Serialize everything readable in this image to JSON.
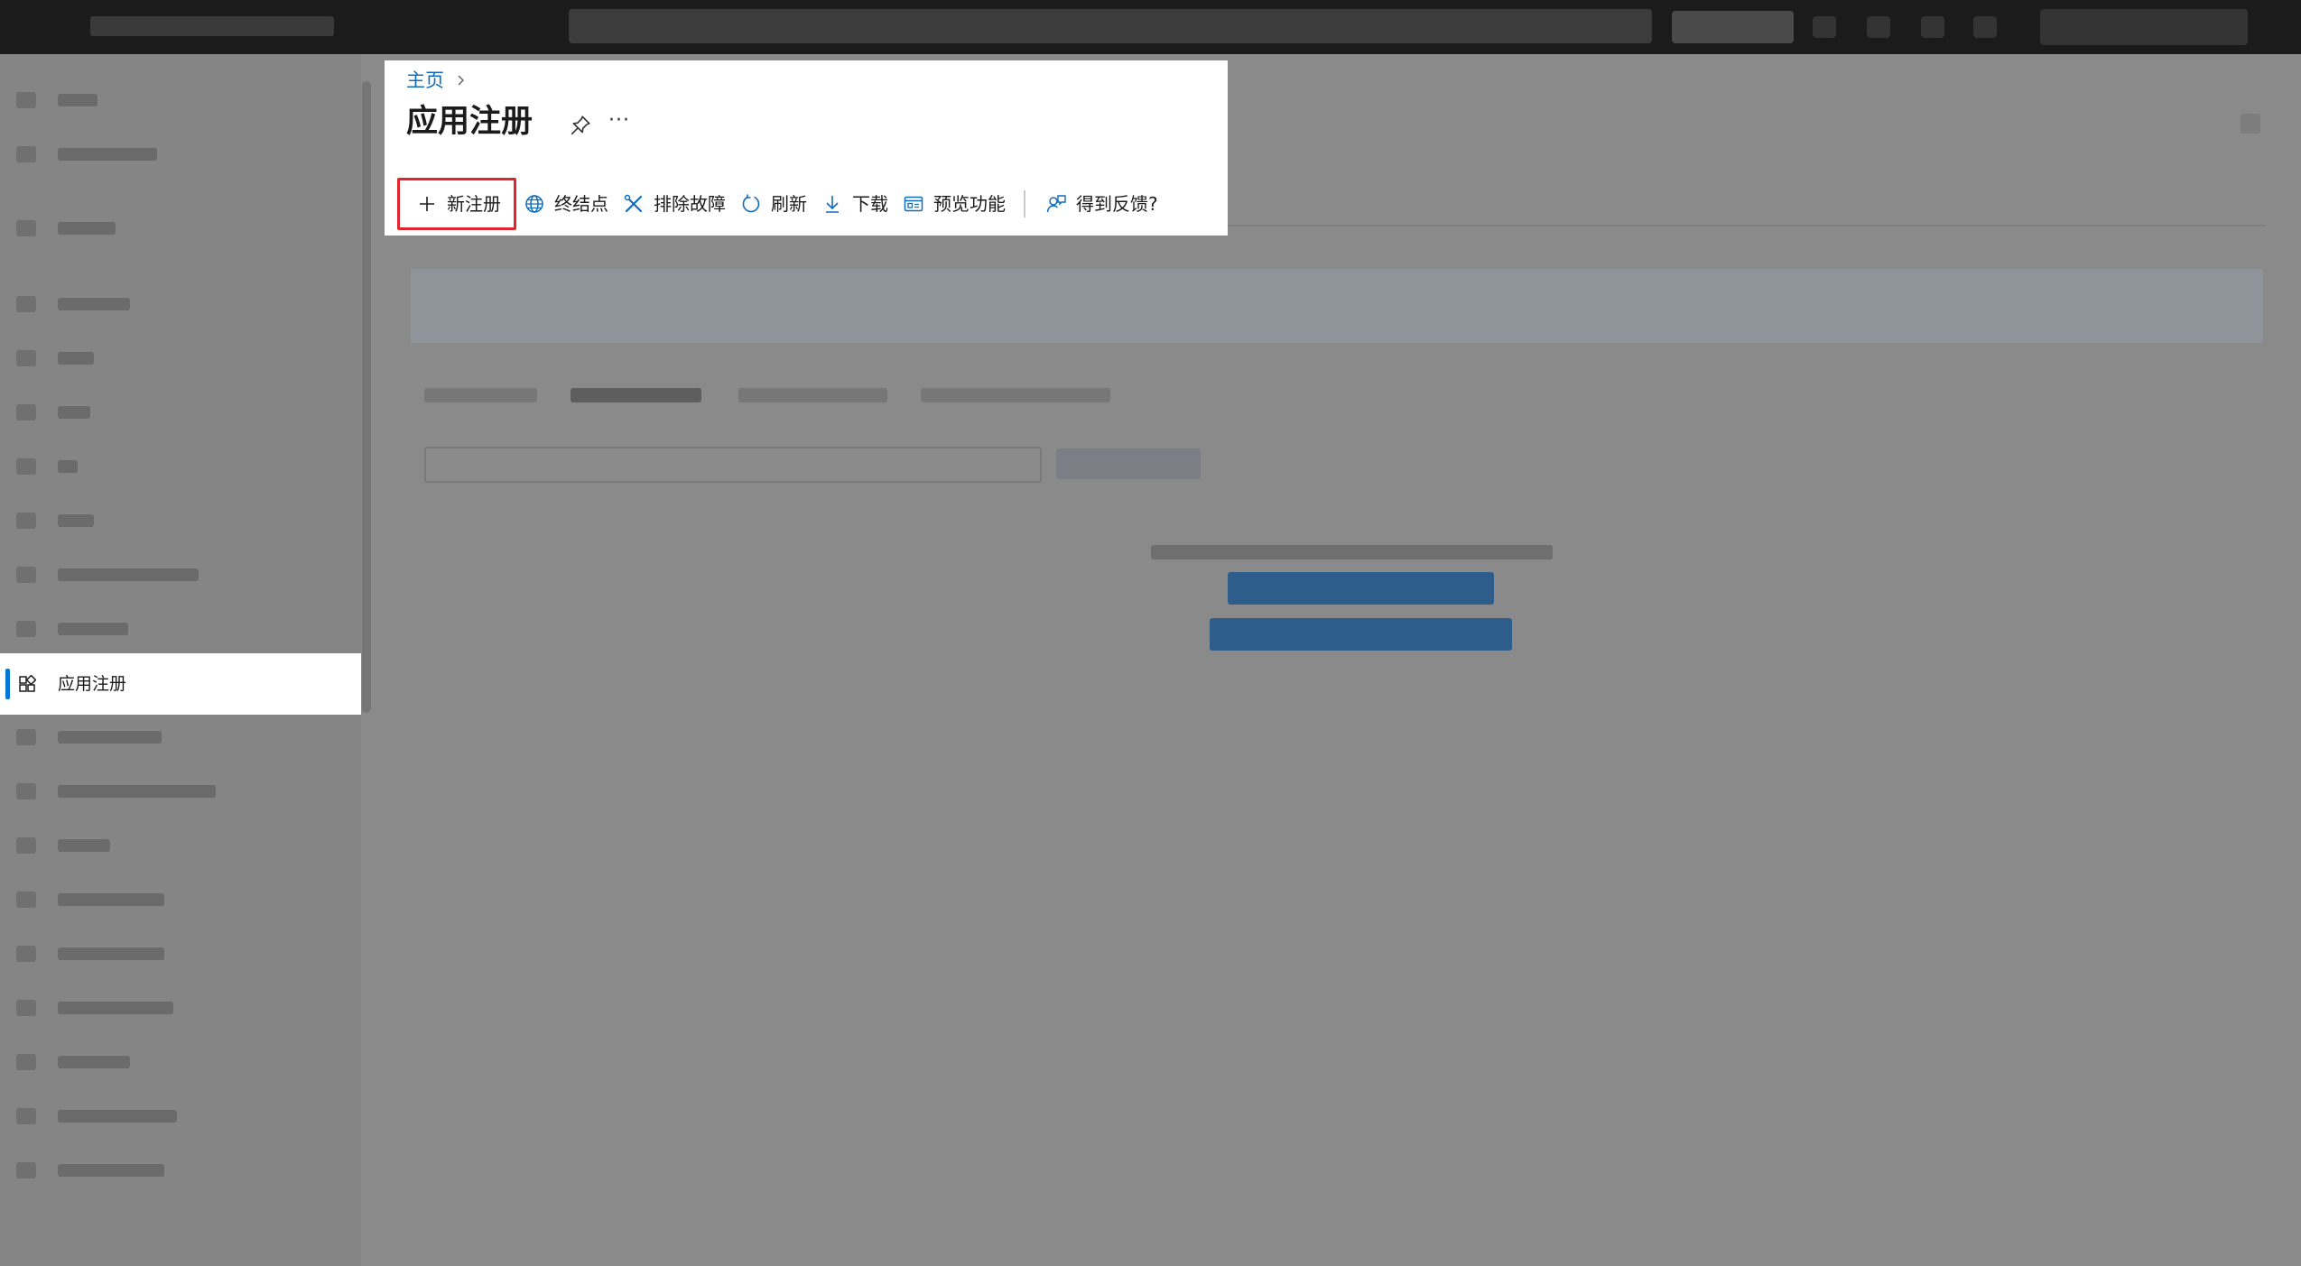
{
  "breadcrumb": {
    "home": "主页"
  },
  "page": {
    "title": "应用注册"
  },
  "toolbar": {
    "new_registration": "新注册",
    "endpoints": "终结点",
    "troubleshoot": "排除故障",
    "refresh": "刷新",
    "download": "下载",
    "preview_features": "预览功能",
    "feedback": "得到反馈?"
  },
  "sidebar": {
    "active_item": {
      "label": "应用注册",
      "icon": "app-registrations-icon"
    }
  },
  "colors": {
    "accent": "#0f6cbd",
    "highlight_border": "#e0262c",
    "active_bar": "#0078d4"
  }
}
